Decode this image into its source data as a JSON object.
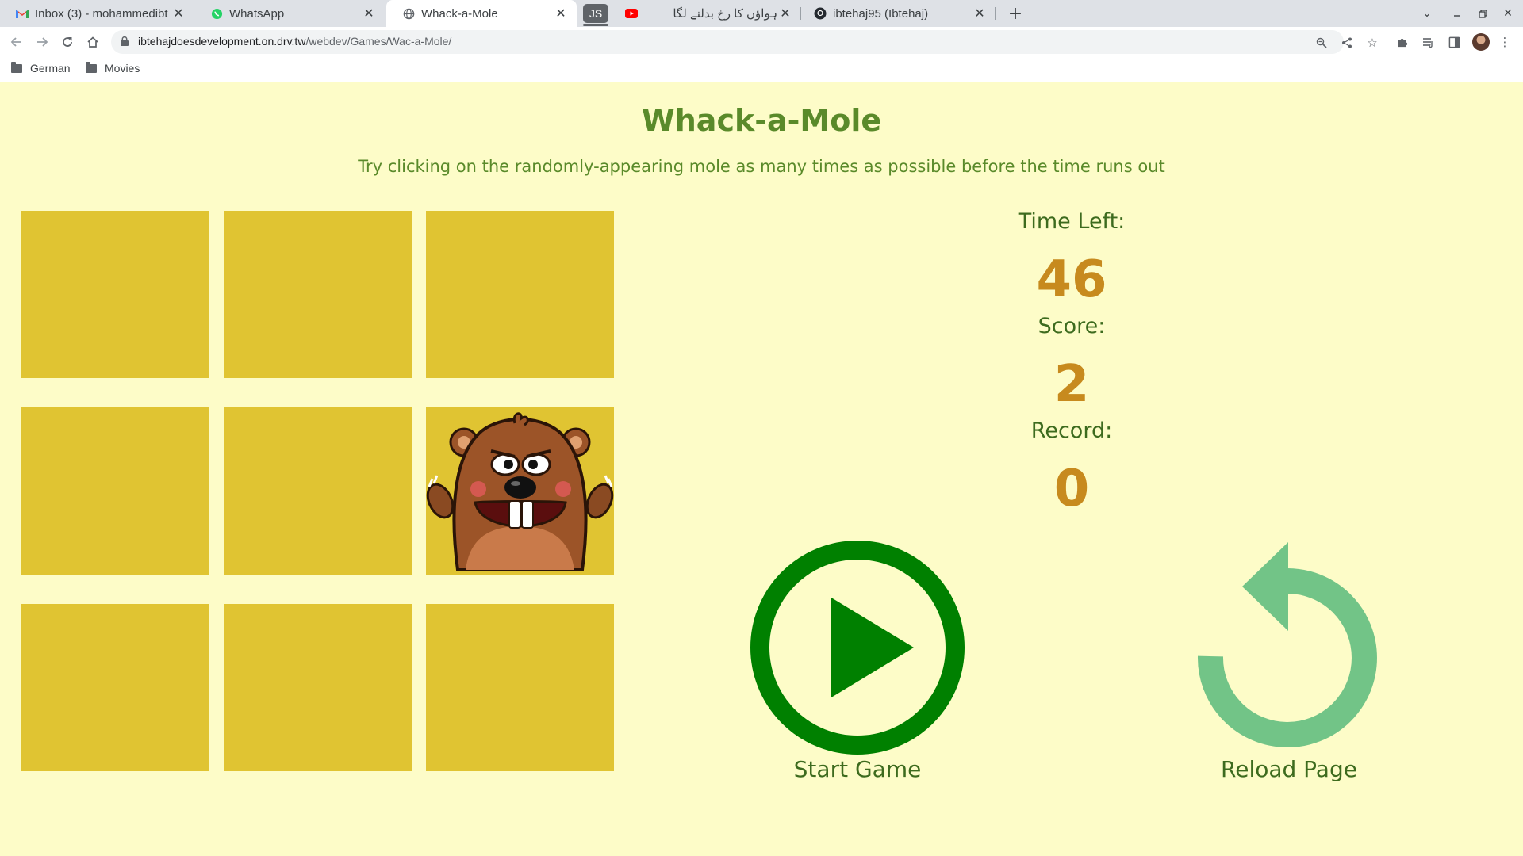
{
  "browser": {
    "tabs": [
      {
        "title": "Inbox (3) - mohammedibt",
        "icon": "gmail-icon"
      },
      {
        "title": "WhatsApp",
        "icon": "whatsapp-icon"
      },
      {
        "title": "Whack-a-Mole",
        "icon": "globe-icon"
      },
      {
        "title": "ہواؤں کا رخ بدلنے لگا",
        "icon": "youtube-icon"
      },
      {
        "title": "ibtehaj95 (Ibtehaj)",
        "icon": "github-icon"
      }
    ],
    "tab_group_label": "JS",
    "url_domain": "ibtehajdoesdevelopment.on.drv.tw",
    "url_path": "/webdev/Games/Wac-a-Mole/",
    "bookmarks": [
      "German",
      "Movies"
    ]
  },
  "game": {
    "title": "Whack-a-Mole",
    "subtitle": "Try clicking on the randomly-appearing mole as many times as possible before the time runs out",
    "mole_square_index": 5,
    "stats": {
      "time_label": "Time Left:",
      "time_value": "46",
      "score_label": "Score:",
      "score_value": "2",
      "record_label": "Record:",
      "record_value": "0"
    },
    "start_label": "Start Game",
    "reload_label": "Reload Page"
  },
  "colors": {
    "background": "#fdfcc8",
    "square": "#e0c432",
    "heading": "#5a8a2a",
    "stat_value": "#c78a1e",
    "start_button": "#008000",
    "reload_button": "#72c487"
  }
}
